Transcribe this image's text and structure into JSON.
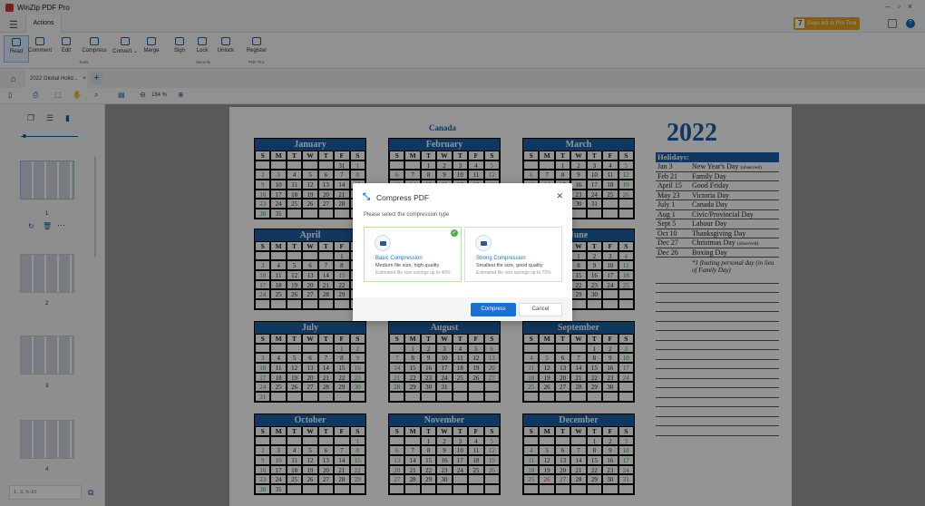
{
  "app": {
    "title": "WinZip PDF Pro",
    "trial_days": "7",
    "trial_text": "Days left in Pro Trial"
  },
  "menu": {
    "tab": "Actions"
  },
  "ribbon": {
    "buttons": [
      "Read",
      "Comment",
      "Edit",
      "Compress",
      "Convert ⌄",
      "Merge",
      "Sign",
      "Lock",
      "Unlock",
      "Register"
    ],
    "groups": [
      "Tools",
      "Security",
      "PDF Pro"
    ]
  },
  "tabs": {
    "doc": "2022 Global Holid...",
    "close": "×",
    "add": "+"
  },
  "viewbar": {
    "zoom": "184 %"
  },
  "sidebar": {
    "pages": [
      "1",
      "2",
      "3",
      "4"
    ],
    "page_range_placeholder": "1, 3, 5-10"
  },
  "document": {
    "country": "Canada",
    "year": "2022",
    "weekdays": [
      "S",
      "M",
      "T",
      "W",
      "T",
      "F",
      "S"
    ],
    "months": [
      {
        "name": "January",
        "start": 6,
        "days": 31,
        "prev": [
          "31"
        ],
        "holidays": [
          3
        ]
      },
      {
        "name": "February",
        "start": 2,
        "days": 28,
        "prev": [],
        "holidays": [
          21
        ]
      },
      {
        "name": "March",
        "start": 2,
        "days": 31,
        "prev": [],
        "holidays": []
      },
      {
        "name": "April",
        "start": 5,
        "days": 30,
        "prev": [],
        "holidays": [
          15
        ]
      },
      {
        "name": "May",
        "start": 0,
        "days": 31,
        "prev": [],
        "holidays": [
          23
        ]
      },
      {
        "name": "June",
        "start": 3,
        "days": 30,
        "prev": [],
        "holidays": []
      },
      {
        "name": "July",
        "start": 5,
        "days": 31,
        "prev": [],
        "holidays": [
          1
        ]
      },
      {
        "name": "August",
        "start": 1,
        "days": 31,
        "prev": [],
        "holidays": [
          1
        ]
      },
      {
        "name": "September",
        "start": 4,
        "days": 30,
        "prev": [],
        "holidays": [
          5
        ]
      },
      {
        "name": "October",
        "start": 6,
        "days": 31,
        "prev": [],
        "holidays": [
          10
        ]
      },
      {
        "name": "November",
        "start": 2,
        "days": 30,
        "prev": [],
        "holidays": []
      },
      {
        "name": "December",
        "start": 4,
        "days": 31,
        "prev": [],
        "holidays": [
          26,
          27
        ]
      }
    ],
    "holidays_title": "Holidays:",
    "holidays": [
      {
        "date": "Jan 3",
        "name": "New Year's Day",
        "note": "(observed)"
      },
      {
        "date": "Feb 21",
        "name": "Family Day",
        "note": ""
      },
      {
        "date": "April 15",
        "name": "Good Friday",
        "note": ""
      },
      {
        "date": "May 23",
        "name": "Victoria Day",
        "note": ""
      },
      {
        "date": "July 1",
        "name": "Canada Day",
        "note": ""
      },
      {
        "date": "Aug 1",
        "name": "Civic/Provincial Day",
        "note": ""
      },
      {
        "date": "Sept 5",
        "name": "Labour Day",
        "note": ""
      },
      {
        "date": "Oct 10",
        "name": "Thanksgiving Day",
        "note": ""
      },
      {
        "date": "Dec 27",
        "name": "Christmas Day",
        "note": "(observed)"
      },
      {
        "date": "Dec 26",
        "name": "Boxing Day",
        "note": ""
      }
    ],
    "footnote": "*1 floating personal day (in lieu of Family Day)"
  },
  "dialog": {
    "title": "Compress PDF",
    "subtitle": "Please select the compression type",
    "options": [
      {
        "title": "Basic Compression",
        "desc": "Medium file size, high quality",
        "savings": "Estimated file size savings up to 40%",
        "selected": true
      },
      {
        "title": "Strong Compression",
        "desc": "Smallest file size, good quality",
        "savings": "Estimated file size savings up to 75%",
        "selected": false
      }
    ],
    "compress": "Compress",
    "cancel": "Cancel"
  }
}
